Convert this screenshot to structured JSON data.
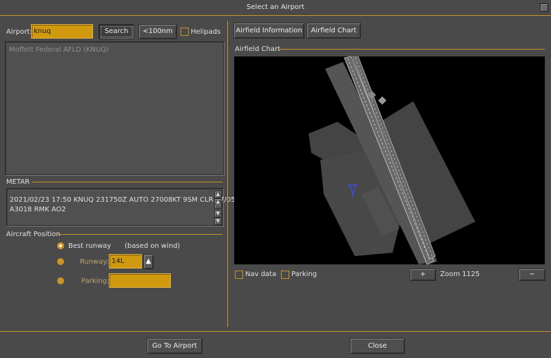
{
  "window": {
    "title": "Select an Airport"
  },
  "search": {
    "airport_label": "Airport:",
    "airport_value": "knuq",
    "search_label": "Search",
    "range_label": "<100nm",
    "helipads_label": "Helipads"
  },
  "results": {
    "items": [
      "Moffett Federal AFLD   (KNUQ)"
    ]
  },
  "metar": {
    "heading": "METAR",
    "line1": "2021/02/23 17:50 KNUQ 231750Z AUTO 27008KT 9SM CLR 17/05",
    "line2": "A3018 RMK AO2"
  },
  "position": {
    "heading": "Aircraft Position",
    "best_runway_label": "Best runway",
    "best_runway_note": "(based on wind)",
    "runway_label": "Runway:",
    "runway_value": "14L",
    "parking_label": "Parking:",
    "parking_value": ""
  },
  "tabs": {
    "info": "Airfield Information",
    "chart": "Airfield Chart"
  },
  "chart": {
    "heading": "Airfield Chart",
    "navdata_label": "Nav data",
    "parking_label": "Parking",
    "zoom_in": "+",
    "zoom_out": "−",
    "zoom_text": "Zoom 1125"
  },
  "footer": {
    "goto_label": "Go To Airport",
    "close_label": "Close"
  },
  "colors": {
    "accent": "#c9962a",
    "input_bg": "#d19a0e",
    "chart_bg": "#000000"
  }
}
